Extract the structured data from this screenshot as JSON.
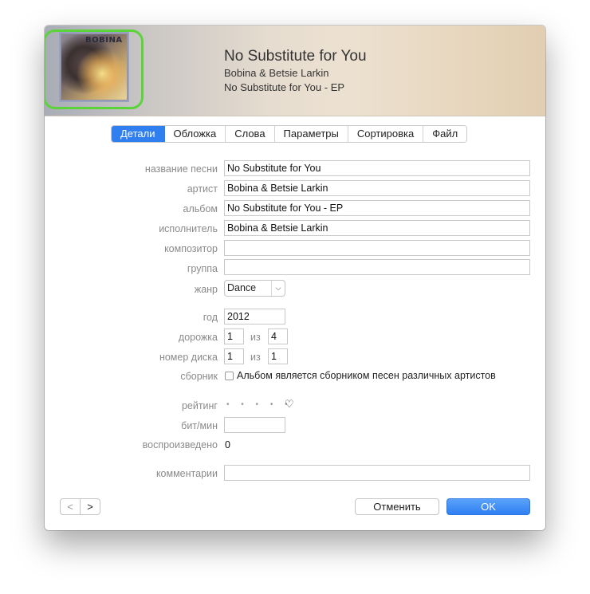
{
  "header": {
    "title": "No Substitute for You",
    "artist": "Bobina & Betsie Larkin",
    "album": "No Substitute for You - EP",
    "artwork_text": "BOBINA"
  },
  "tabs": [
    {
      "label": "Детали",
      "active": true
    },
    {
      "label": "Обложка",
      "active": false
    },
    {
      "label": "Слова",
      "active": false
    },
    {
      "label": "Параметры",
      "active": false
    },
    {
      "label": "Сортировка",
      "active": false
    },
    {
      "label": "Файл",
      "active": false
    }
  ],
  "fields": {
    "song_name": {
      "label": "название песни",
      "value": "No Substitute for You"
    },
    "artist": {
      "label": "артист",
      "value": "Bobina & Betsie Larkin"
    },
    "album": {
      "label": "альбом",
      "value": "No Substitute for You - EP"
    },
    "album_artist": {
      "label": "исполнитель",
      "value": "Bobina & Betsie Larkin"
    },
    "composer": {
      "label": "композитор",
      "value": ""
    },
    "group": {
      "label": "группа",
      "value": ""
    },
    "genre": {
      "label": "жанр",
      "value": "Dance"
    },
    "year": {
      "label": "год",
      "value": "2012"
    },
    "track": {
      "label": "дорожка",
      "value": "1",
      "of_label": "из",
      "total": "4"
    },
    "disc": {
      "label": "номер диска",
      "value": "1",
      "of_label": "из",
      "total": "1"
    },
    "compilation": {
      "label": "сборник",
      "checked": false,
      "text": "Альбом является сборником песен различных артистов"
    },
    "rating": {
      "label": "рейтинг",
      "dots": "• • • • •",
      "heart": "♡"
    },
    "bpm": {
      "label": "бит/мин",
      "value": ""
    },
    "play_count": {
      "label": "воспроизведено",
      "value": "0"
    },
    "comments": {
      "label": "комментарии",
      "value": ""
    }
  },
  "nav": {
    "prev": "<",
    "next": ">"
  },
  "buttons": {
    "cancel": "Отменить",
    "ok": "OK"
  },
  "colors": {
    "accent": "#2f7ff0",
    "artwork_highlight": "#5bd43a"
  }
}
